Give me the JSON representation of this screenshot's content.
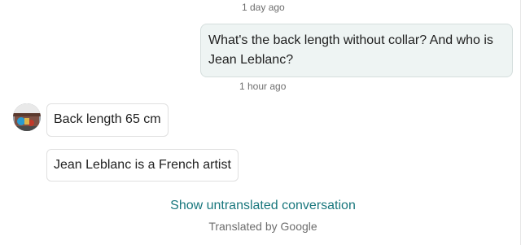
{
  "conversation": {
    "messages": [
      {
        "timestamp": "1 day ago",
        "direction": "outgoing",
        "text": "What's the back length without collar? And who is Jean Leblanc?"
      },
      {
        "timestamp": "1 hour ago",
        "direction": "incoming",
        "replies": [
          "Back length 65 cm",
          "Jean Leblanc is a French artist"
        ]
      }
    ],
    "show_untranslated_label": "Show untranslated conversation",
    "translated_by_label": "Translated by Google"
  },
  "colors": {
    "link": "#19777d",
    "outgoing_bubble": "#eef4f3",
    "muted_text": "#6e6e6e"
  },
  "icons": {
    "avatar": "user-avatar-photo"
  }
}
